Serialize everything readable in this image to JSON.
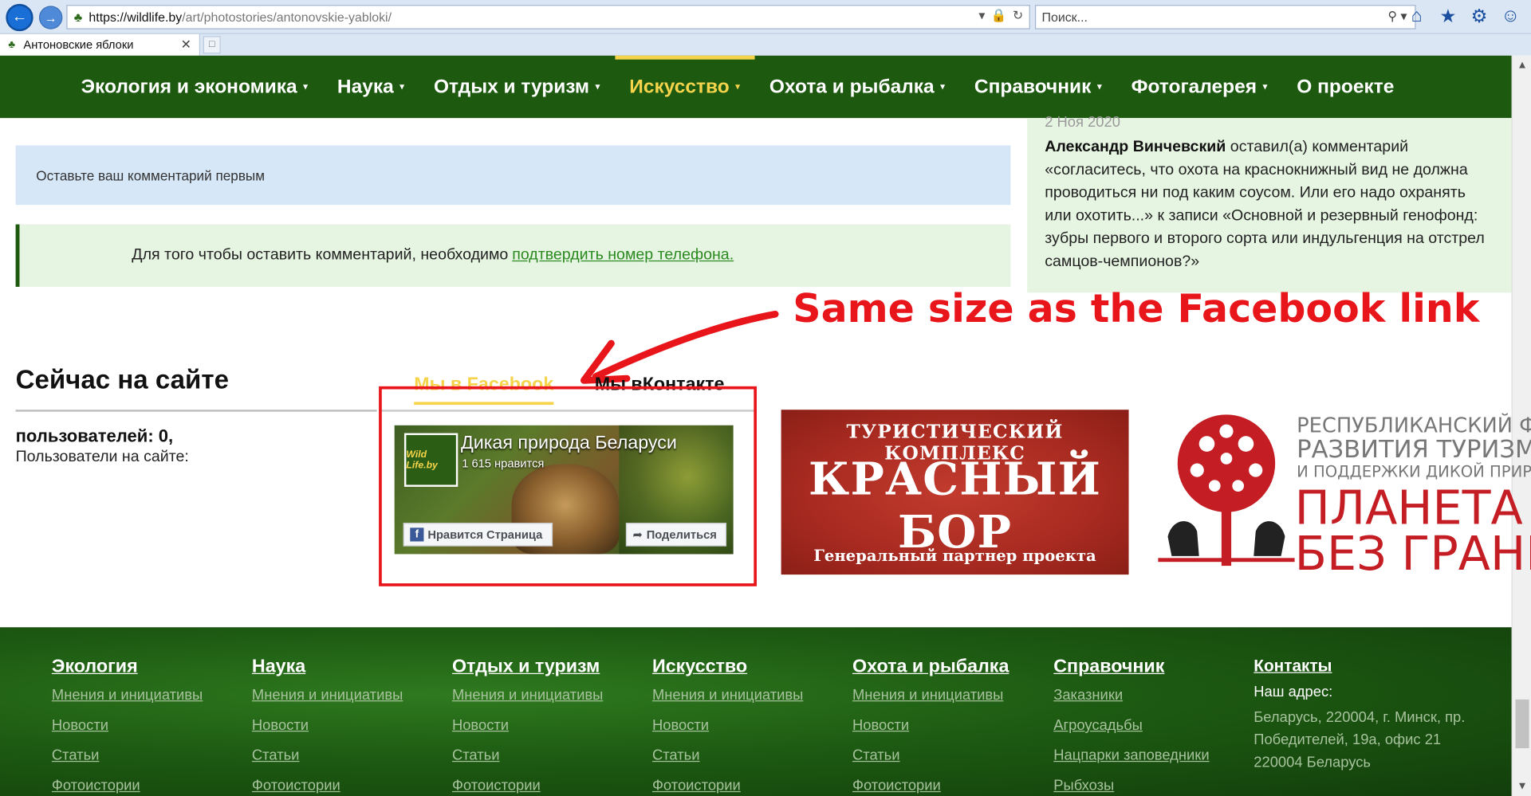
{
  "browser": {
    "url_host": "https://wildlife.by",
    "url_path": "/art/photostories/antonovskie-yabloki/",
    "search_placeholder": "Поиск...",
    "tab_title": "Антоновские яблоки"
  },
  "nav": {
    "items": [
      {
        "label": "Экология и экономика",
        "active": false
      },
      {
        "label": "Наука",
        "active": false
      },
      {
        "label": "Отдых и туризм",
        "active": false
      },
      {
        "label": "Искусство",
        "active": true
      },
      {
        "label": "Охота и рыбалка",
        "active": false
      },
      {
        "label": "Справочник",
        "active": false
      },
      {
        "label": "Фотогалерея",
        "active": false
      },
      {
        "label": "О проекте",
        "active": false
      }
    ],
    "active_color": "#f5d44b",
    "bg_color": "#1e5910"
  },
  "comments": {
    "empty_text": "Оставьте ваш комментарий первым",
    "phone_text": "Для того чтобы оставить комментарий, необходимо",
    "phone_link": "подтвердить номер телефона."
  },
  "latest": {
    "date": "2 Ноя 2020",
    "author": "Александр Винчевский",
    "text": " оставил(а) комментарий «согласитесь, что охота на краснокнижный вид не должна проводиться ни под каким соусом. Или его надо охранять или охотить...» к записи «Основной и резервный генофонд: зубры первого и второго сорта или индульгенция на отстрел самцов-чемпионов?»"
  },
  "annotation": {
    "text": "Same size as the Facebook link",
    "color": "#e8151b"
  },
  "online": {
    "title": "Сейчас на сайте",
    "users": "пользователей: 0,",
    "sub": "Пользователи на сайте:"
  },
  "social": {
    "tab_facebook": "Мы в Facebook",
    "tab_vk": "Мы вКонтакте",
    "fb_page_name": "Дикая природа Беларуси",
    "fb_likes": "1 615 нравится",
    "fb_like_btn": "Нравится Страница",
    "fb_share_btn": "Поделиться",
    "fb_logo_text": "Wild Life.by"
  },
  "banners": {
    "krasny_top": "ТУРИСТИЧЕСКИЙ КОМПЛЕКС",
    "krasny_main": "КРАСНЫЙ БОР",
    "krasny_bottom": "Генеральный партнер проекта",
    "planeta_line1": "РЕСПУБЛИКАНСКИЙ ФОНД",
    "planeta_line2": "РАЗВИТИЯ ТУРИЗМА",
    "planeta_line3": "И ПОДДЕРЖКИ ДИКОЙ ПРИРОДЫ",
    "planeta_big1": "ПЛАНЕТА",
    "planeta_big2": "БЕЗ ГРАНИЦ"
  },
  "footer": {
    "columns": [
      {
        "head": "Экология",
        "links": [
          "Мнения и инициативы",
          "Новости",
          "Статьи",
          "Фотоистории"
        ]
      },
      {
        "head": "Наука",
        "links": [
          "Мнения и инициативы",
          "Новости",
          "Статьи",
          "Фотоистории"
        ]
      },
      {
        "head": "Отдых и туризм",
        "links": [
          "Мнения и инициативы",
          "Новости",
          "Статьи",
          "Фотоистории"
        ]
      },
      {
        "head": "Искусство",
        "links": [
          "Мнения и инициативы",
          "Новости",
          "Статьи",
          "Фотоистории"
        ]
      },
      {
        "head": "Охота и рыбалка",
        "links": [
          "Мнения и инициативы",
          "Новости",
          "Статьи",
          "Фотоистории"
        ]
      },
      {
        "head": "Справочник",
        "links": [
          "Заказники",
          "Агроусадьбы",
          "Нацпарки заповедники",
          "Рыбхозы"
        ]
      }
    ],
    "contacts_head": "Контакты",
    "address_label": "Наш адрес:",
    "address": "Беларусь, 220004, г. Минск, пр. Победителей, 19а, офис 21 220004 Беларусь"
  }
}
